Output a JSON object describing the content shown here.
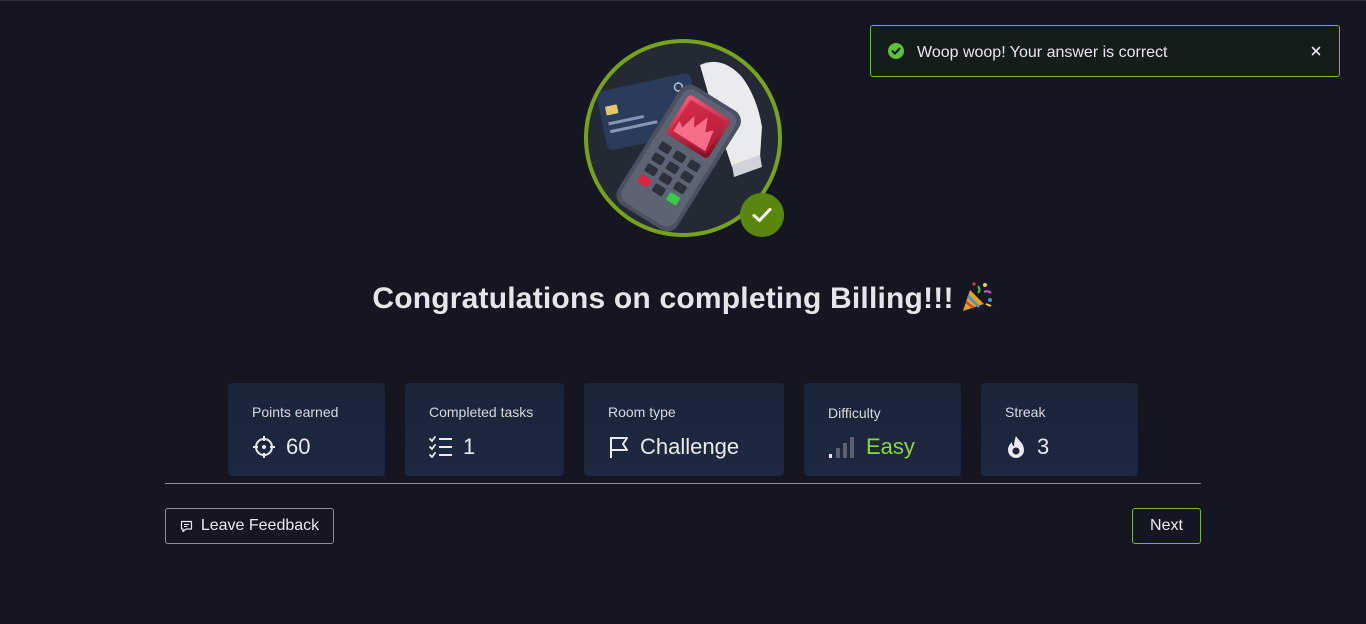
{
  "toast": {
    "message": "Woop woop! Your answer is correct"
  },
  "title": "Congratulations on completing Billing!!!",
  "stats": {
    "points": {
      "label": "Points earned",
      "value": "60"
    },
    "tasks": {
      "label": "Completed tasks",
      "value": "1"
    },
    "room_type": {
      "label": "Room type",
      "value": "Challenge"
    },
    "difficulty": {
      "label": "Difficulty",
      "value": "Easy"
    },
    "streak": {
      "label": "Streak",
      "value": "3"
    }
  },
  "actions": {
    "feedback_label": "Leave Feedback",
    "next_label": "Next"
  },
  "colors": {
    "accent": "#78b83a",
    "easy": "#8cd83a",
    "background": "#141722",
    "card": "#1c2437"
  }
}
